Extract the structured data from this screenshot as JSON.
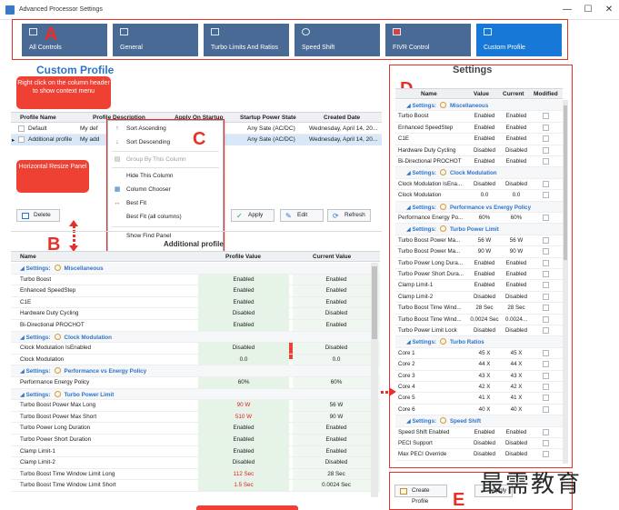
{
  "window": {
    "title": "Advanced Processor Settings",
    "min": "—",
    "max": "☐",
    "close": "✕"
  },
  "nav": {
    "items": [
      {
        "label": "All Controls"
      },
      {
        "label": "General"
      },
      {
        "label": "Turbo Limits And Ratios"
      },
      {
        "label": "Speed Shift"
      },
      {
        "label": "FIVR Control"
      },
      {
        "label": "Custom Profile"
      }
    ]
  },
  "annotations": {
    "A": "A",
    "B": "B",
    "C": "C",
    "D": "D",
    "E": "E",
    "B2": "B",
    "callout_context": "Right click on the column header to show context menu",
    "callout_horizontal": "Horizontal Resize Panel",
    "callout_vertical": "Vertical Resize Panel."
  },
  "profiles": {
    "title": "Custom Profile",
    "columns": [
      "Profile Name",
      "Profile Description",
      "Apply On Startup",
      "Startup Power State",
      "Created Date"
    ],
    "rows": [
      {
        "name": "Default",
        "desc": "My def",
        "state": "Any Sate (AC/DC)",
        "date": "Wednesday, April 14, 20..."
      },
      {
        "name": "Additional profile",
        "desc": "My add",
        "state": "Any Sate (AC/DC)",
        "date": "Wednesday, April 14, 20..."
      }
    ],
    "buttons": {
      "delete": "Delete",
      "apply": "Apply",
      "edit": "Edit",
      "refresh": "Refresh"
    }
  },
  "context_menu": {
    "items": [
      {
        "label": "Sort Ascending",
        "icon": "↑"
      },
      {
        "label": "Sort Descending",
        "icon": "↓"
      },
      {
        "label": "Group By This Column",
        "icon": "▤"
      },
      {
        "label": "Hide This Column",
        "icon": ""
      },
      {
        "label": "Column Chooser",
        "icon": "▦"
      },
      {
        "label": "Best Fit",
        "icon": "↔"
      },
      {
        "label": "Best Fit (all columns)",
        "icon": ""
      },
      {
        "label": "Show Find Panel",
        "icon": ""
      }
    ]
  },
  "details": {
    "title": "Additional profile",
    "columns": [
      "Name",
      "Profile Value",
      "Current Value"
    ],
    "rows": [
      {
        "group": "Settings:",
        "label": "Miscellaneous"
      },
      {
        "name": "Turbo Boost",
        "profile": "Enabled",
        "current": "Enabled"
      },
      {
        "name": "Enhanced SpeedStep",
        "profile": "Enabled",
        "current": "Enabled"
      },
      {
        "name": "C1E",
        "profile": "Enabled",
        "current": "Enabled"
      },
      {
        "name": "Hardware Duty Cycling",
        "profile": "Disabled",
        "current": "Disabled"
      },
      {
        "name": "Bi-Directional PROCHOT",
        "profile": "Enabled",
        "current": "Enabled"
      },
      {
        "group": "Settings:",
        "label": "Clock Modulation"
      },
      {
        "name": "Clock Modulation IsEnabled",
        "profile": "Disabled",
        "current": "Disabled"
      },
      {
        "name": "Clock Modulation",
        "profile": "0.0",
        "current": "0.0"
      },
      {
        "group": "Settings:",
        "label": "Performance vs Energy Policy"
      },
      {
        "name": "Performance Energy Policy",
        "profile": "60%",
        "current": "60%"
      },
      {
        "group": "Settings:",
        "label": "Turbo Power Limit"
      },
      {
        "name": "Turbo Boost Power Max Long",
        "profile": "90 W",
        "current": "56 W",
        "changed": true
      },
      {
        "name": "Turbo Boost Power Max Short",
        "profile": "510 W",
        "current": "90 W",
        "changed": true
      },
      {
        "name": "Turbo Power Long Duration",
        "profile": "Enabled",
        "current": "Enabled"
      },
      {
        "name": "Turbo Power Short Duration",
        "profile": "Enabled",
        "current": "Enabled"
      },
      {
        "name": "Clamp Limit-1",
        "profile": "Enabled",
        "current": "Enabled"
      },
      {
        "name": "Clamp Limit-2",
        "profile": "Disabled",
        "current": "Disabled"
      },
      {
        "name": "Turbo Boost Time Window Limit Long",
        "profile": "112 Sec",
        "current": "28 Sec",
        "changed": true
      },
      {
        "name": "Turbo Boost Time Window Limit Short",
        "profile": "1.5 Sec",
        "current": "0.0024 Sec",
        "changed": true
      }
    ]
  },
  "settings": {
    "title": "Settings",
    "columns": [
      "Name",
      "Value",
      "Current",
      "Modified"
    ],
    "rows": [
      {
        "group": "Settings:",
        "label": "Miscellaneous"
      },
      {
        "name": "Turbo Boost",
        "value": "Enabled",
        "current": "Enabled"
      },
      {
        "name": "Enhanced SpeedStep",
        "value": "Enabled",
        "current": "Enabled"
      },
      {
        "name": "C1E",
        "value": "Enabled",
        "current": "Enabled"
      },
      {
        "name": "Hardware Duty Cycling",
        "value": "Disabled",
        "current": "Disabled"
      },
      {
        "name": "Bi-Directional PROCHOT",
        "value": "Enabled",
        "current": "Enabled"
      },
      {
        "group": "Settings:",
        "label": "Clock Modulation"
      },
      {
        "name": "Clock Modulation IsEna...",
        "value": "Disabled",
        "current": "Disabled"
      },
      {
        "name": "Clock Modulation",
        "value": "0.0",
        "current": "0.0"
      },
      {
        "group": "Settings:",
        "label": "Performance vs Energy Policy"
      },
      {
        "name": "Performance Energy Po...",
        "value": "60%",
        "current": "60%"
      },
      {
        "group": "Settings:",
        "label": "Turbo Power Limit"
      },
      {
        "name": "Turbo Boost Power Ma...",
        "value": "56 W",
        "current": "56 W"
      },
      {
        "name": "Turbo Boost Power Ma...",
        "value": "90 W",
        "current": "90 W"
      },
      {
        "name": "Turbo Power Long Dura...",
        "value": "Enabled",
        "current": "Enabled"
      },
      {
        "name": "Turbo Power Short Dura...",
        "value": "Enabled",
        "current": "Enabled"
      },
      {
        "name": "Clamp Limit-1",
        "value": "Enabled",
        "current": "Enabled"
      },
      {
        "name": "Clamp Limit-2",
        "value": "Disabled",
        "current": "Disabled"
      },
      {
        "name": "Turbo Boost Time Wind...",
        "value": "28 Sec",
        "current": "28 Sec"
      },
      {
        "name": "Turbo Boost Time Wind...",
        "value": "0.0024 Sec",
        "current": "0.0024..."
      },
      {
        "name": "Turbo Power Limit Lock",
        "value": "Disabled",
        "current": "Disabled"
      },
      {
        "group": "Settings:",
        "label": "Turbo Ratios"
      },
      {
        "name": "Core 1",
        "value": "45 X",
        "current": "45 X"
      },
      {
        "name": "Core 2",
        "value": "44 X",
        "current": "44 X"
      },
      {
        "name": "Core 3",
        "value": "43 X",
        "current": "43 X"
      },
      {
        "name": "Core 4",
        "value": "42 X",
        "current": "42 X"
      },
      {
        "name": "Core 5",
        "value": "41 X",
        "current": "41 X"
      },
      {
        "name": "Core 6",
        "value": "40 X",
        "current": "40 X"
      },
      {
        "group": "Settings:",
        "label": "Speed Shift"
      },
      {
        "name": "Speed Shift Enabled",
        "value": "Enabled",
        "current": "Enabled"
      },
      {
        "name": "PECI Support",
        "value": "Disabled",
        "current": "Disabled"
      },
      {
        "name": "Max PECI Override",
        "value": "Disabled",
        "current": "Disabled"
      }
    ],
    "buttons": {
      "create": "Create Profile",
      "apply": "Apply"
    }
  },
  "watermark": "最需教育",
  "colors": {
    "accent": "#1878d8",
    "nav": "#4a6a96",
    "annotation": "#e8302a",
    "changed": "#e02020",
    "group": "#2e74c6"
  }
}
